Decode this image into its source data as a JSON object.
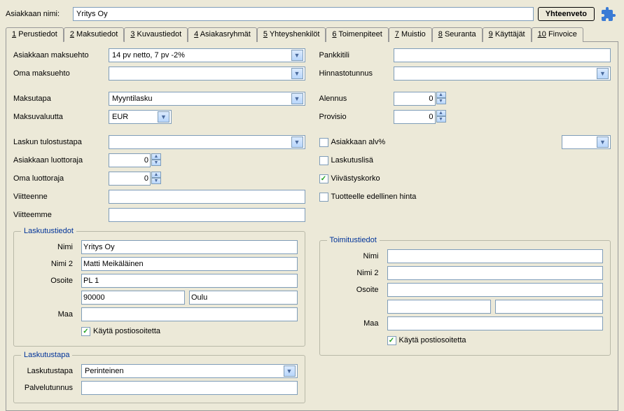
{
  "header": {
    "customerNameLabel": "Asiakkaan nimi:",
    "customerName": "Yritys Oy",
    "summaryBtn": "Yhteenveto"
  },
  "tabs": [
    {
      "num": "1",
      "label": "Perustiedot"
    },
    {
      "num": "2",
      "label": "Maksutiedot"
    },
    {
      "num": "3",
      "label": "Kuvaustiedot"
    },
    {
      "num": "4",
      "label": "Asiakasryhmät"
    },
    {
      "num": "5",
      "label": "Yhteyshenkilöt"
    },
    {
      "num": "6",
      "label": "Toimenpiteet"
    },
    {
      "num": "7",
      "label": "Muistio"
    },
    {
      "num": "8",
      "label": "Seuranta"
    },
    {
      "num": "9",
      "label": "Käyttäjät"
    },
    {
      "num": "10",
      "label": "Finvoice"
    }
  ],
  "left": {
    "l_paymentTerm": "Asiakkaan maksuehto",
    "paymentTerm": "14 pv netto, 7 pv -2%",
    "l_ownTerm": "Oma maksuehto",
    "ownTerm": "",
    "l_payMethod": "Maksutapa",
    "payMethod": "Myyntilasku",
    "l_currency": "Maksuvaluutta",
    "currency": "EUR",
    "l_printMethod": "Laskun tulostustapa",
    "printMethod": "",
    "l_custCredit": "Asiakkaan luottoraja",
    "custCredit": "0",
    "l_ownCredit": "Oma luottoraja",
    "ownCredit": "0",
    "l_refIn": "Viitteenne",
    "refIn": "",
    "l_refOut": "Viitteemme",
    "refOut": ""
  },
  "right": {
    "l_bank": "Pankkitili",
    "bank": "",
    "l_pricelist": "Hinnastotunnus",
    "pricelist": "",
    "l_discount": "Alennus",
    "discount": "0",
    "l_commission": "Provisio",
    "commission": "0",
    "chk_vat": "Asiakkaan alv%",
    "chk_fee": "Laskutuslisä",
    "chk_interest": "Viivästyskorko",
    "chk_prevPrice": "Tuotteelle edellinen hinta"
  },
  "billing": {
    "legend": "Laskutustiedot",
    "l_name": "Nimi",
    "name": "Yritys Oy",
    "l_name2": "Nimi 2",
    "name2": "Matti Meikäläinen",
    "l_addr": "Osoite",
    "addr": "PL 1",
    "zip": "90000",
    "city": "Oulu",
    "l_country": "Maa",
    "country": "",
    "chk_post": "Käytä postiosoitetta"
  },
  "delivery": {
    "legend": "Toimitustiedot",
    "l_name": "Nimi",
    "name": "",
    "l_name2": "Nimi 2",
    "name2": "",
    "l_addr": "Osoite",
    "addr": "",
    "zip": "",
    "city": "",
    "l_country": "Maa",
    "country": "",
    "chk_post": "Käytä postiosoitetta"
  },
  "billingMethod": {
    "legend": "Laskutustapa",
    "l_method": "Laskutustapa",
    "method": "Perinteinen",
    "l_service": "Palvelutunnus",
    "service": ""
  }
}
